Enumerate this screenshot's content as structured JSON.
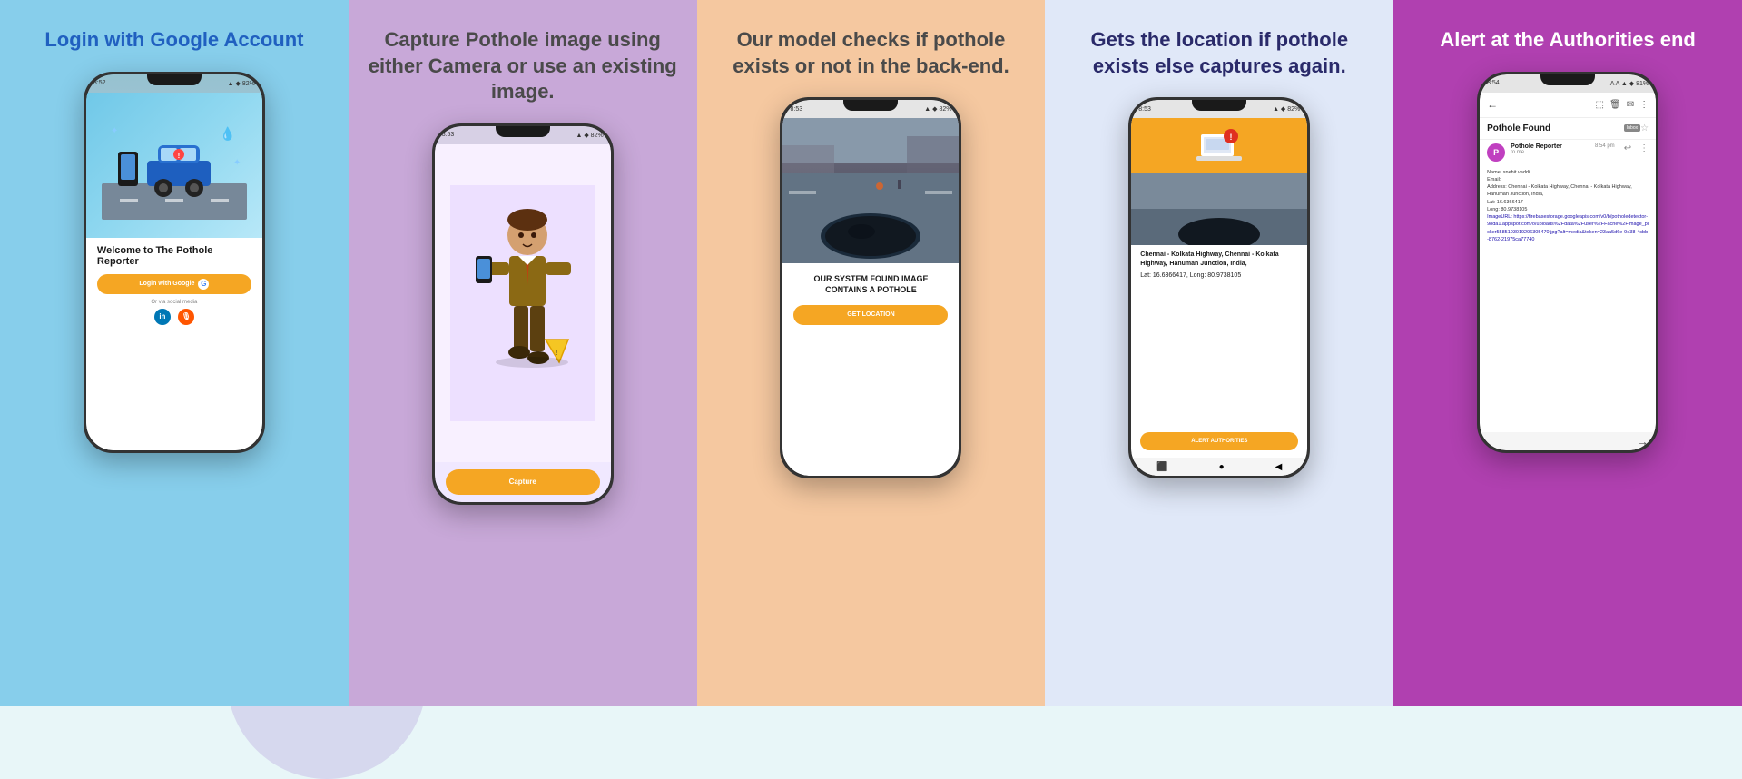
{
  "background": {
    "color": "#e8f6f8",
    "circle_top_color": "rgba(100,200,210,0.4)",
    "circle_bottom_color": "rgba(180,160,220,0.35)"
  },
  "panels": [
    {
      "id": "panel-1",
      "bg_color": "#87CEEB",
      "title": "Login with Google Account",
      "title_color": "#2060C0",
      "phone": {
        "status_left": "8:52",
        "welcome_text": "Welcome to The Pothole Reporter",
        "google_btn_label": "Login with Google",
        "or_text": "Or via social media",
        "linkedin_color": "#0077B5",
        "podcast_color": "#FF5500"
      }
    },
    {
      "id": "panel-2",
      "bg_color": "#C8A8D8",
      "title": "Capture Pothole image using either Camera or use an existing image.",
      "title_color": "#4A4A4A",
      "phone": {
        "status_left": "8:53",
        "capture_btn_label": "Capture"
      }
    },
    {
      "id": "panel-3",
      "bg_color": "#F5C8A0",
      "title": "Our model checks if pothole exists or not in the back-end.",
      "title_color": "#4A4A4A",
      "phone": {
        "status_left": "8:53",
        "result_text": "OUR SYSTEM FOUND IMAGE CONTAINS A POTHOLE",
        "location_btn_label": "GET LOCATION"
      }
    },
    {
      "id": "panel-4",
      "bg_color": "#E0E8F8",
      "title": "Gets the location if pothole exists else captures again.",
      "title_color": "#2A2A6A",
      "phone": {
        "status_left": "8:53",
        "location_text": "Chennai - Kolkata Highway, Chennai - Kolkata Highway, Hanuman Junction, India,",
        "lat_long": "Lat: 16.6366417, Long: 80.9738105",
        "alert_btn_label": "ALERT AUTHORITIES"
      }
    },
    {
      "id": "panel-5",
      "bg_color": "#B040B0",
      "title": "Alert at the Authorities end",
      "title_color": "#FFFFFF",
      "phone": {
        "status_left": "8:54",
        "email_subject": "Pothole Found",
        "inbox_label": "Inbox",
        "time": "8:54 pm",
        "sender_initial": "P",
        "sender_to_label": "to me",
        "body_name": "Name: snehit vaddi",
        "body_email": "Email:",
        "body_address": "Address: Chennai - Kolkata Highway, Chennai - Kolkata Highway, Hanuman Junction, India,",
        "body_lat": "Lat: 16.6366417",
        "body_long": "Long: 80.9738105",
        "body_imageurl": "ImageURL: https://firebasestorage.googleapis.com/v0/b/potholedetector-98da1.appspot.com/o/uploads%2Fdata%2Fuser%2FFache%2Fimage_picker5585103019296305470.jpg?alt=media&token=23aa5d6e-9e38-4cbb-8762-21975ca77740",
        "arrow_right": "→"
      }
    }
  ]
}
